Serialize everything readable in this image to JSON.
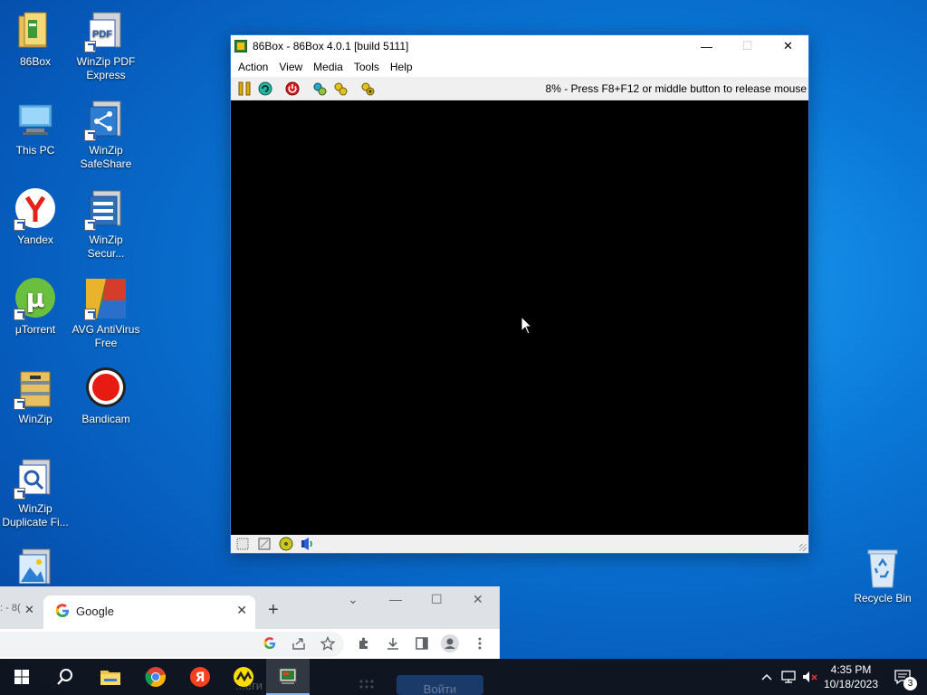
{
  "desktop": {
    "icons": [
      {
        "label": "86Box"
      },
      {
        "label": "WinZip PDF Express"
      },
      {
        "label": "This PC"
      },
      {
        "label": "WinZip SafeShare"
      },
      {
        "label": "Yandex"
      },
      {
        "label": "WinZip Secur..."
      },
      {
        "label": "μTorrent"
      },
      {
        "label": "AVG AntiVirus Free"
      },
      {
        "label": "WinZip"
      },
      {
        "label": "Bandicam"
      },
      {
        "label": "WinZip Duplicate Fi..."
      },
      {
        "label": ""
      },
      {
        "label": "Recycle Bin"
      }
    ]
  },
  "emulator_window": {
    "title": "86Box - 86Box 4.0.1 [build 5111]",
    "menu": [
      "Action",
      "View",
      "Media",
      "Tools",
      "Help"
    ],
    "toolbar_icons": [
      "pause-icon",
      "reset-icon",
      "power-icon",
      "settings-icon",
      "hard-reset-icon",
      "screenshot-icon"
    ],
    "status_message": "8% - Press F8+F12 or middle button to release mouse",
    "statusbar_icons": [
      "floppy-drive-icon",
      "floppy-drive-2-icon",
      "cdrom-icon",
      "sound-icon"
    ],
    "caption": {
      "minimize": "—",
      "maximize": "☐",
      "close": "✕"
    }
  },
  "browser_window": {
    "prev_tab_text": ": - 8(",
    "active_tab_title": "Google",
    "new_tab": "+",
    "caption": {
      "dropdown": "⌄",
      "minimize": "—",
      "maximize": "☐",
      "close": "✕"
    },
    "toolbar_icons": [
      "google-lens-icon",
      "share-icon",
      "bookmark-star-icon",
      "extensions-icon",
      "download-icon",
      "side-panel-icon",
      "profile-icon",
      "menu-icon"
    ]
  },
  "page_peek": {
    "text": "...еги",
    "button": "Войти"
  },
  "taskbar": {
    "apps": [
      "start-icon",
      "search-icon",
      "file-explorer-icon",
      "chrome-icon",
      "yandex-browser-icon",
      "toloka-icon",
      "86box-icon"
    ],
    "time": "4:35 PM",
    "date": "10/18/2023",
    "notifications_count": "3"
  }
}
